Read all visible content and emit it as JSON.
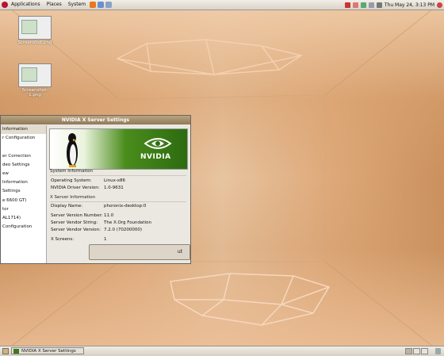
{
  "top_panel": {
    "menus": [
      "Applications",
      "Places",
      "System"
    ],
    "clock": "Thu May 24,  3:13 PM"
  },
  "desktop_icons": [
    {
      "label": "Screenshot.png"
    },
    {
      "label": "Screenshot-1.png"
    }
  ],
  "nvidia_window": {
    "title": "NVIDIA X Server Settings",
    "sidebar_items": [
      "Information",
      "r Configuration",
      "",
      "er Correction",
      "deo Settings",
      "ew",
      "Information",
      "Settings",
      "e 6600 GT)",
      "tor",
      "AL1714)",
      "Configuration"
    ],
    "banner_logo_text": "NVIDIA",
    "system_info": {
      "heading": "System Information",
      "rows": [
        {
          "label": "Operating System:",
          "value": "Linux-x86"
        },
        {
          "label": "NVIDIA Driver Version:",
          "value": "1.0-9631"
        }
      ]
    },
    "xserver_info": {
      "heading": "X Server Information",
      "rows": [
        {
          "label": "Display Name:",
          "value": "phoronix-desktop:0"
        },
        {
          "label": "Server Version Number:",
          "value": "11.0"
        },
        {
          "label": "Server Vendor String:",
          "value": "The X.Org Foundation"
        },
        {
          "label": "Server Vendor Version:",
          "value": "7.2.0 (70200000)"
        },
        {
          "label": "X Screens:",
          "value": "1"
        }
      ]
    },
    "quit_button": "ut"
  },
  "taskbar": {
    "active_window": "NVIDIA X Server Settings"
  }
}
